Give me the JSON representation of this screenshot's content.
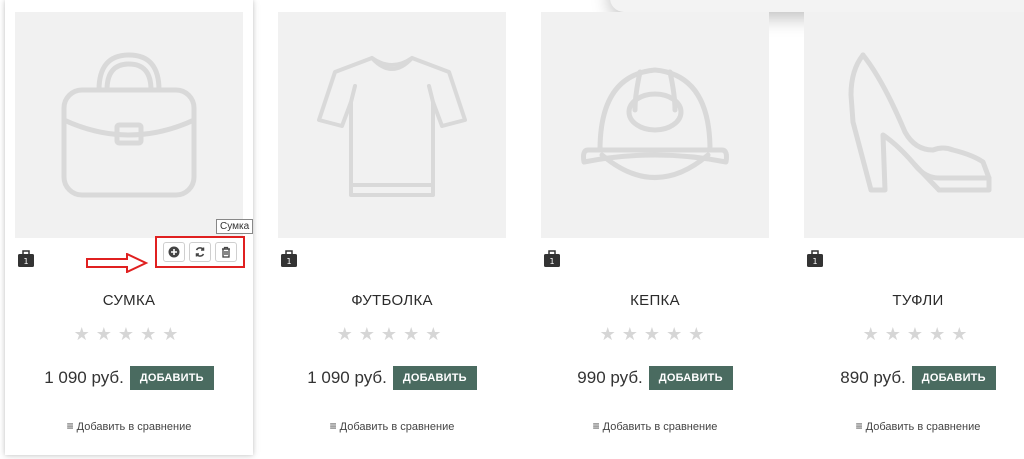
{
  "products": [
    {
      "title": "СУМКА",
      "price": "1 090 руб.",
      "add_label": "ДОБАВИТЬ",
      "compare_label": "Добавить в сравнение",
      "badge": "1",
      "rating": 0,
      "icon": "bag-icon"
    },
    {
      "title": "ФУТБОЛКА",
      "price": "1 090 руб.",
      "add_label": "ДОБАВИТЬ",
      "compare_label": "Добавить в сравнение",
      "badge": "1",
      "rating": 0,
      "icon": "tshirt-icon"
    },
    {
      "title": "КЕПКА",
      "price": "990 руб.",
      "add_label": "ДОБАВИТЬ",
      "compare_label": "Добавить в сравнение",
      "badge": "1",
      "rating": 0,
      "icon": "cap-icon"
    },
    {
      "title": "ТУФЛИ",
      "price": "890 руб.",
      "add_label": "ДОБАВИТЬ",
      "compare_label": "Добавить в сравнение",
      "badge": "1",
      "rating": 0,
      "icon": "shoe-icon"
    }
  ],
  "tooltip": "Сумка",
  "stars": "★★★★★",
  "colors": {
    "button": "#4a6b60",
    "highlight": "#e02020",
    "placeholder": "#f1f1f1",
    "icon_stroke": "#d9d9d9"
  },
  "card_actions": [
    "zoom-icon",
    "refresh-icon",
    "trash-icon"
  ]
}
